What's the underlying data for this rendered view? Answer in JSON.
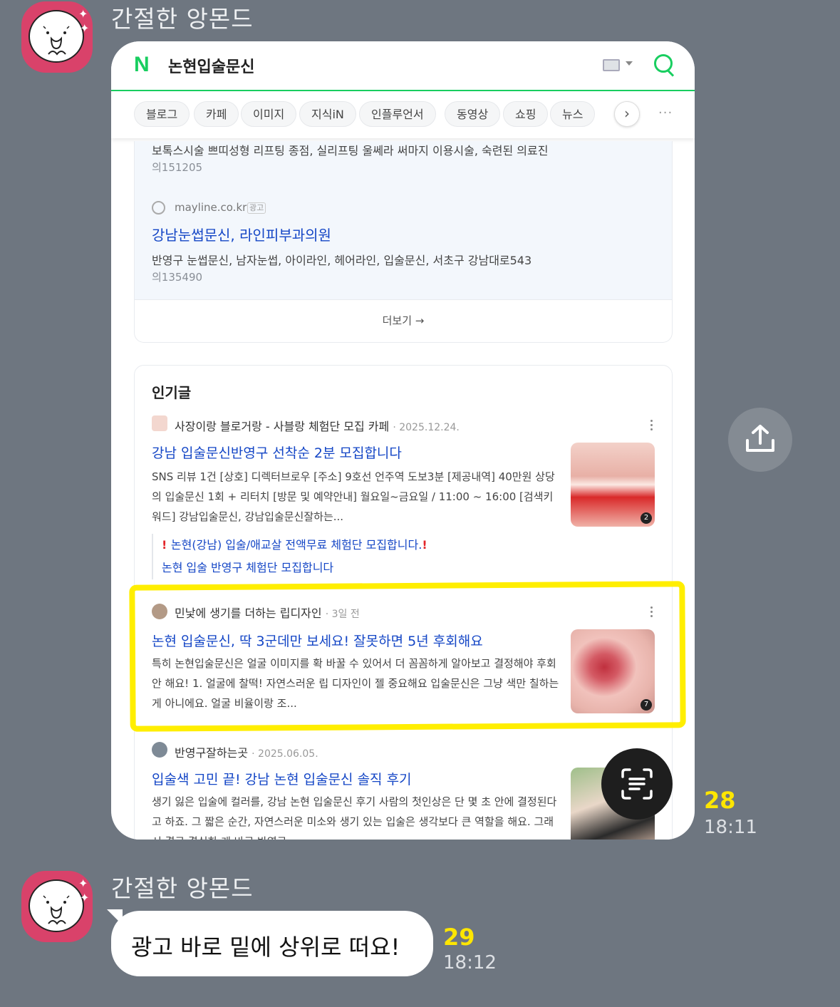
{
  "messages": [
    {
      "sender": "간절한 앙몬드",
      "type": "image",
      "read_count": "28",
      "time": "18:11",
      "screenshot": {
        "query": "논현입술문신",
        "tabs": [
          "블로그",
          "카페",
          "이미지",
          "지식iN",
          "인플루언서",
          "동영상",
          "쇼핑",
          "뉴스"
        ],
        "ads": [
          {
            "desc": "보톡스시술 쁘띠성형 리프팅 종점, 실리프팅 울쎄라 써마지 이용시술, 숙련된 의료진",
            "sub": "의151205"
          },
          {
            "domain": "mayline.co.kr",
            "badge": "광고",
            "title": "강남눈썹문신, 라인피부과의원",
            "desc": "반영구 눈썹문신, 남자눈썹, 아이라인, 헤어라인, 입술문신, 서초구 강남대로543",
            "sub": "의135490"
          }
        ],
        "more_label": "더보기 →",
        "popular_title": "인기글",
        "posts": [
          {
            "source": "사장이랑 블로거랑 - 사블랑 체험단 모집 카페",
            "date": "· 2025.12.24.",
            "title": "강남 입술문신반영구 선착순 2분 모집합니다",
            "body": "SNS 리뷰 1건 [상호] 디렉터브로우 [주소] 9호선 언주역 도보3분 [제공내역] 40만원 상당의 입술문신 1회 + 리터치 [방문 및 예약안내] 월요일~금요일 / 11:00 ~ 16:00 [검색키워드] 강남입술문신, 강남입술문신잘하는...",
            "thumb_count": "2",
            "sub_links": [
              "논현(강남) 입술/애교살 전액무료 체험단 모집합니다.",
              "논현 입술 반영구 체험단 모집합니다"
            ]
          },
          {
            "source": "민낯에 생기를 더하는 립디자인",
            "date": "· 3일 전",
            "title": "논현 입술문신, 딱 3군데만 보세요! 잘못하면 5년 후회해요",
            "body": "특히 논현입술문신은 얼굴 이미지를 확 바꿀 수 있어서 더 꼼꼼하게 알아보고 결정해야 후회 안 해요! 1. 얼굴에 찰떡! 자연스러운 립 디자인이 젤 중요해요 입술문신은 그냥 색만 칠하는 게 아니에요. 얼굴 비율이랑 조...",
            "thumb_count": "7"
          },
          {
            "source": "반영구잘하는곳",
            "date": "· 2025.06.05.",
            "title": "입술색 고민 끝! 강남 논현 입술문신 솔직 후기",
            "body": "생기 잃은 입술에 컬러를, 강남 논현 입술문신 후기 사람의 첫인상은 단 몇 초 안에 결정된다고 하죠. 그 짧은 순간, 자연스러운 미소와 생기 있는 입술은 생각보다 큰 역할을 해요. 그래서 결국 결심한 게 바로 반영구"
          }
        ]
      }
    },
    {
      "sender": "간절한 앙몬드",
      "type": "text",
      "text": "광고 바로 밑에 상위로 떠요!",
      "read_count": "29",
      "time": "18:12"
    }
  ],
  "colors": {
    "chat_bg": "#6e7680",
    "unread_count": "#ffe600",
    "naver_green": "#19ce60",
    "link_blue": "#1446c6",
    "highlight_yellow": "#ffee00",
    "avatar_pink": "#d9426a"
  },
  "icons": [
    "share-icon",
    "text-scan-icon",
    "search-icon",
    "keyboard-icon",
    "chevron-right-icon",
    "more-dots-icon",
    "globe-icon",
    "kebab-icon"
  ]
}
